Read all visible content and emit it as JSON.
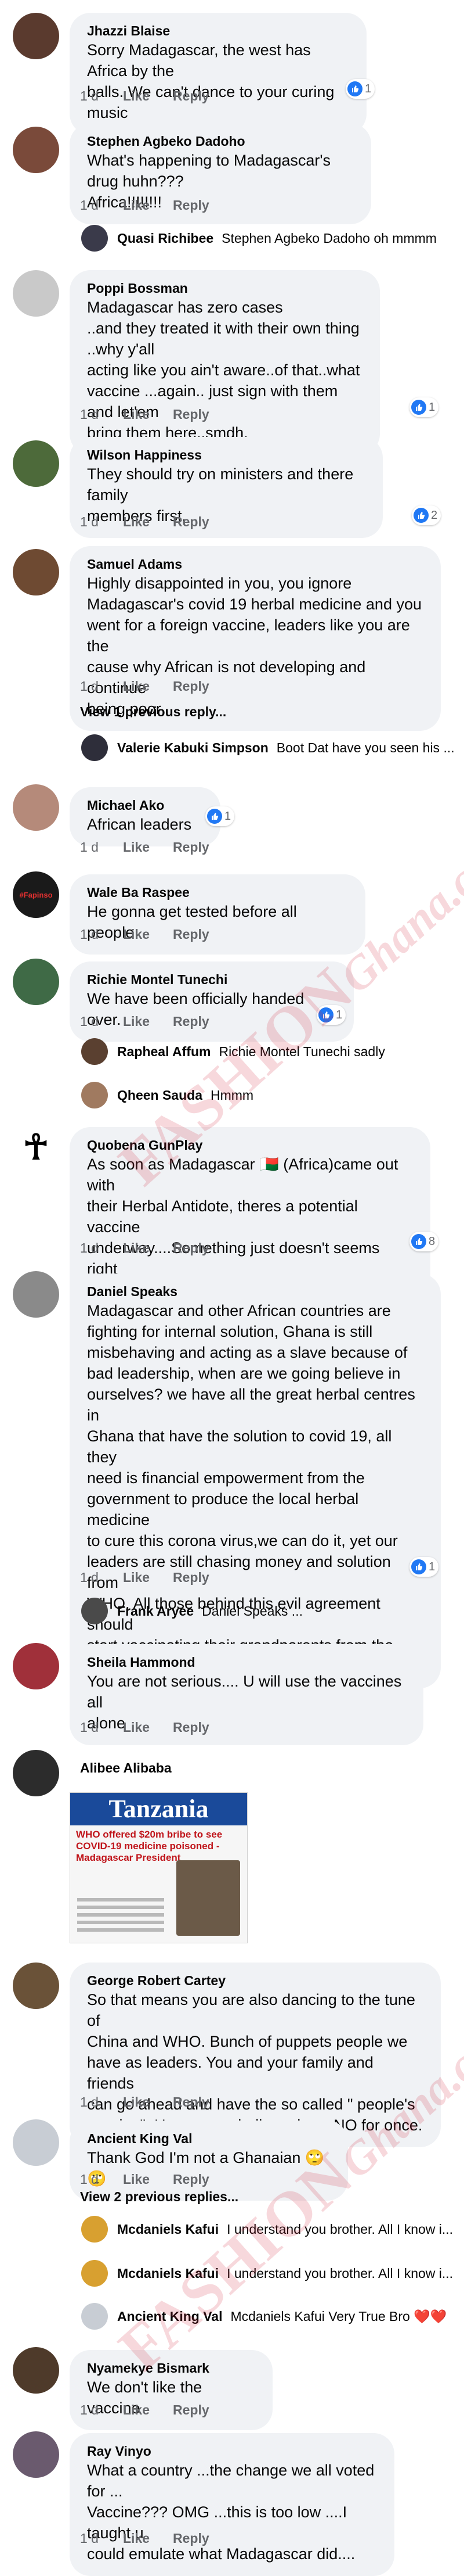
{
  "comments": [
    {
      "name": "Jhazzi Blaise",
      "text": "Sorry Madagascar, the west has Africa by the\nballs. We can't dance to your curing music",
      "time": "1 d",
      "like": "Like",
      "reply": "Reply",
      "reactions": "1"
    },
    {
      "name": "Stephen Agbeko Dadoho",
      "text": "What's happening to Madagascar's drug huhn???\nAfrica!!!!!!!!",
      "time": "1 d",
      "like": "Like",
      "reply": "Reply",
      "replies": [
        {
          "name": "Quasi Richibee",
          "text": "Stephen Agbeko Dadoho oh mmmm"
        }
      ]
    },
    {
      "name": "Poppi Bossman",
      "text": "Madagascar has zero cases\n..and they treated it with their own thing ..why y'all\nacting like you ain't aware..of that..what\nvaccine ...again.. just sign with them and let'em\nbring them here..smdh.",
      "time": "1 d",
      "like": "Like",
      "reply": "Reply",
      "reactions": "1"
    },
    {
      "name": "Wilson Happiness",
      "text": "They should try on ministers and there family\nmembers first.",
      "time": "1 d",
      "like": "Like",
      "reply": "Reply",
      "reactions": "2"
    },
    {
      "name": "Samuel Adams",
      "text": "Highly disappointed in you, you ignore\nMadagascar's covid 19 herbal medicine and you\nwent for a foreign vaccine, leaders like you are the\ncause why African is not developing and continue\nbeing poor",
      "time": "1 d",
      "like": "Like",
      "reply": "Reply",
      "view_previous": "View 1 previous reply...",
      "replies": [
        {
          "name": "Valerie Kabuki Simpson",
          "text": "Boot Dat have you seen his ..."
        }
      ]
    },
    {
      "name": "Michael Ako",
      "text": "African leaders",
      "time": "1 d",
      "like": "Like",
      "reply": "Reply",
      "reactions": "1"
    },
    {
      "name": "Wale Ba Raspee",
      "text": "He gonna get tested before all  people",
      "time": "1 d",
      "like": "Like",
      "reply": "Reply"
    },
    {
      "name": "Richie Montel Tunechi",
      "text": "We have been officially handed over.",
      "time": "1 d",
      "like": "Like",
      "reply": "Reply",
      "reactions": "1",
      "replies": [
        {
          "name": "Rapheal Affum",
          "text": "Richie Montel Tunechi sadly"
        },
        {
          "name": "Qheen Sauda",
          "text": "Hmmm"
        }
      ]
    },
    {
      "name": "Quobena GunPlay",
      "text": "As soon as Madagascar 🇲🇬 (Africa)came out with\ntheir Herbal Antidote, theres a potential vaccine\nunderway....Something just doesn't seems right\n🤔",
      "time": "1 d",
      "like": "Like",
      "reply": "Reply",
      "reactions": "8"
    },
    {
      "name": "Daniel Speaks",
      "text": "Madagascar and other African countries are\nfighting for internal solution, Ghana is still\nmisbehaving and acting as a slave because of\nbad leadership, when are we going believe in\nourselves? we have all the great herbal centres in\nGhana that have the solution to covid 19, all they\nneed is financial empowerment from the\ngovernment to produce the local herbal medicine\nto cure this corona virus,we can do it, yet our\nleaders are still chasing money and solution from\nWHO, All those behind this evil agreement  should\nstart vaccinating their grandparents from the\ngrave.",
      "time": "1 d",
      "like": "Like",
      "reply": "Reply",
      "reactions": "1",
      "replies": [
        {
          "name": "Frank Aryee",
          "text": "Daniel Speaks ..."
        }
      ]
    },
    {
      "name": "Sheila Hammond",
      "text": "You are not serious.... U will use the vaccines all\nalone",
      "time": "1 d",
      "like": "Like",
      "reply": "Reply"
    },
    {
      "name": "Alibee Alibaba",
      "text": "",
      "image": {
        "masthead": "Tanzania",
        "headline": "WHO offered $20m bribe to see COVID-19 medicine poisoned -Madagascar President"
      }
    },
    {
      "name": "George Robert Cartey",
      "text": "So that means you are also dancing to the tune of\nChina and WHO. Bunch of puppets people we\nhave as leaders. You and your family and friends\ncan go ahead and have the so called \" people's\nvaccine\". Have some balls and say NO for once.",
      "time": "1 d",
      "like": "Like",
      "reply": "Reply"
    },
    {
      "name": "Ancient King Val",
      "text": "Thank God I'm not a Ghanaian 🙄🙄",
      "time": "1 d",
      "like": "Like",
      "reply": "Reply",
      "view_previous": "View 2 previous replies...",
      "replies": [
        {
          "name": "Mcdaniels Kafui",
          "text": "I understand you brother. All I know i..."
        },
        {
          "name": "Mcdaniels Kafui",
          "text": "I understand you brother. All I know i..."
        },
        {
          "name": "Ancient King Val",
          "text": "Mcdaniels Kafui Very True Bro ❤️❤️"
        }
      ]
    },
    {
      "name": "Nyamekye Bismark",
      "text": "We don't like the vaccine",
      "time": "1 d",
      "like": "Like",
      "reply": "Reply"
    },
    {
      "name": "Ray Vinyo",
      "text": "What a country ...the change we all voted for ...\nVaccine??? OMG ...this is too low ....I taught u\ncould emulate what Madagascar did....",
      "time": "1 d",
      "like": "Like",
      "reply": "Reply"
    }
  ],
  "watermark": {
    "brand": "FASHION",
    "site": "Ghana.com"
  },
  "colors": {
    "bubble": "#f0f2f5",
    "like_blue": "#2078f4",
    "meta": "#65676b",
    "watermark": "#d2283c"
  },
  "avatar_text": {
    "wale": "#Fapinso"
  }
}
